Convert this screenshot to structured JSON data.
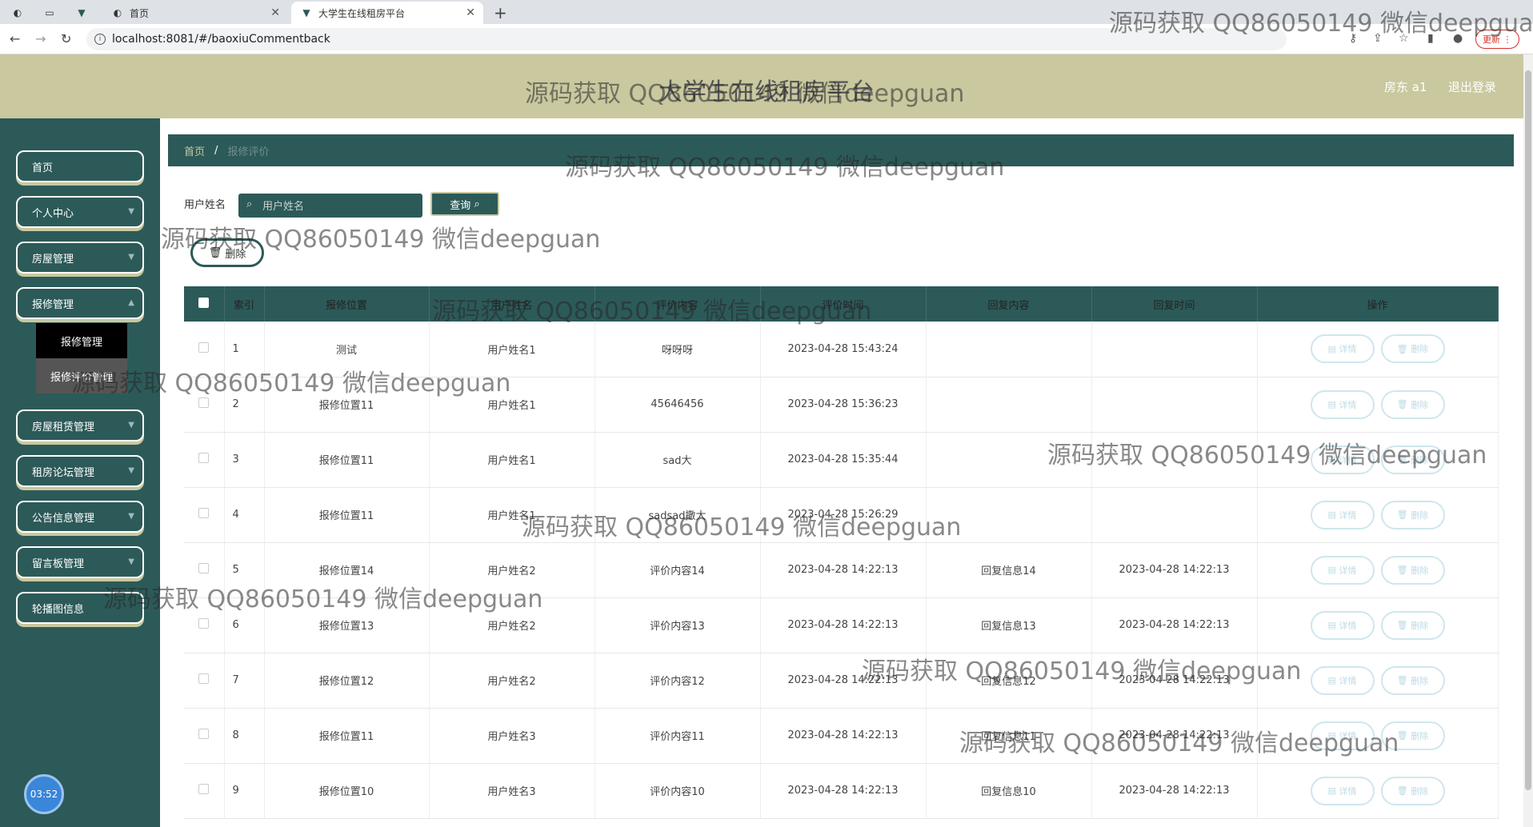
{
  "browser": {
    "tabs": [
      {
        "title": "首页",
        "icon": "globe-icon"
      },
      {
        "title": "大学生在线租房平台",
        "icon": "vue-icon"
      }
    ],
    "url": "localhost:8081/#/baoxiuCommentback",
    "update_label": "更新"
  },
  "header": {
    "title": "大学生在线租房平台",
    "user": "房东 a1",
    "logout": "退出登录"
  },
  "sidebar": {
    "items": [
      {
        "label": "首页"
      },
      {
        "label": "个人中心"
      },
      {
        "label": "房屋管理"
      },
      {
        "label": "报修管理"
      },
      {
        "label": "房屋租赁管理"
      },
      {
        "label": "租房论坛管理"
      },
      {
        "label": "公告信息管理"
      },
      {
        "label": "留言板管理"
      },
      {
        "label": "轮播图信息"
      }
    ],
    "submenu": [
      {
        "label": "报修管理"
      },
      {
        "label": "报修评价管理"
      }
    ],
    "clock": "03:52"
  },
  "breadcrumb": {
    "home": "首页",
    "separator": "/",
    "current": "报修评价"
  },
  "search": {
    "label": "用户姓名",
    "placeholder": "用户姓名",
    "query_label": "查询",
    "delete_label": "删除"
  },
  "table": {
    "columns": [
      "索引",
      "报修位置",
      "用户姓名",
      "评价内容",
      "评价时间",
      "回复内容",
      "回复时间",
      "操作"
    ],
    "detail_label": "详情",
    "delete_label": "删除",
    "rows": [
      {
        "idx": "1",
        "loc": "测试",
        "user": "用户姓名1",
        "content": "呀呀呀",
        "time": "2023-04-28 15:43:24",
        "reply": "",
        "reply_time": ""
      },
      {
        "idx": "2",
        "loc": "报修位置11",
        "user": "用户姓名1",
        "content": "45646456",
        "time": "2023-04-28 15:36:23",
        "reply": "",
        "reply_time": ""
      },
      {
        "idx": "3",
        "loc": "报修位置11",
        "user": "用户姓名1",
        "content": "sad大",
        "time": "2023-04-28 15:35:44",
        "reply": "",
        "reply_time": ""
      },
      {
        "idx": "4",
        "loc": "报修位置11",
        "user": "用户姓名1",
        "content": "sadsad撒大",
        "time": "2023-04-28 15:26:29",
        "reply": "",
        "reply_time": ""
      },
      {
        "idx": "5",
        "loc": "报修位置14",
        "user": "用户姓名2",
        "content": "评价内容14",
        "time": "2023-04-28 14:22:13",
        "reply": "回复信息14",
        "reply_time": "2023-04-28 14:22:13"
      },
      {
        "idx": "6",
        "loc": "报修位置13",
        "user": "用户姓名2",
        "content": "评价内容13",
        "time": "2023-04-28 14:22:13",
        "reply": "回复信息13",
        "reply_time": "2023-04-28 14:22:13"
      },
      {
        "idx": "7",
        "loc": "报修位置12",
        "user": "用户姓名2",
        "content": "评价内容12",
        "time": "2023-04-28 14:22:13",
        "reply": "回复信息12",
        "reply_time": "2023-04-28 14:22:13"
      },
      {
        "idx": "8",
        "loc": "报修位置11",
        "user": "用户姓名3",
        "content": "评价内容11",
        "time": "2023-04-28 14:22:13",
        "reply": "回复信息11",
        "reply_time": "2023-04-28 14:22:13"
      },
      {
        "idx": "9",
        "loc": "报修位置10",
        "user": "用户姓名3",
        "content": "评价内容10",
        "time": "2023-04-28 14:22:13",
        "reply": "回复信息10",
        "reply_time": "2023-04-28 14:22:13"
      }
    ]
  },
  "watermark": "源码获取 QQ86050149 微信deepguan",
  "colors": {
    "primary": "#2c5a58",
    "header_bg": "#c9c89f",
    "action_border": "#cfe6ee"
  }
}
